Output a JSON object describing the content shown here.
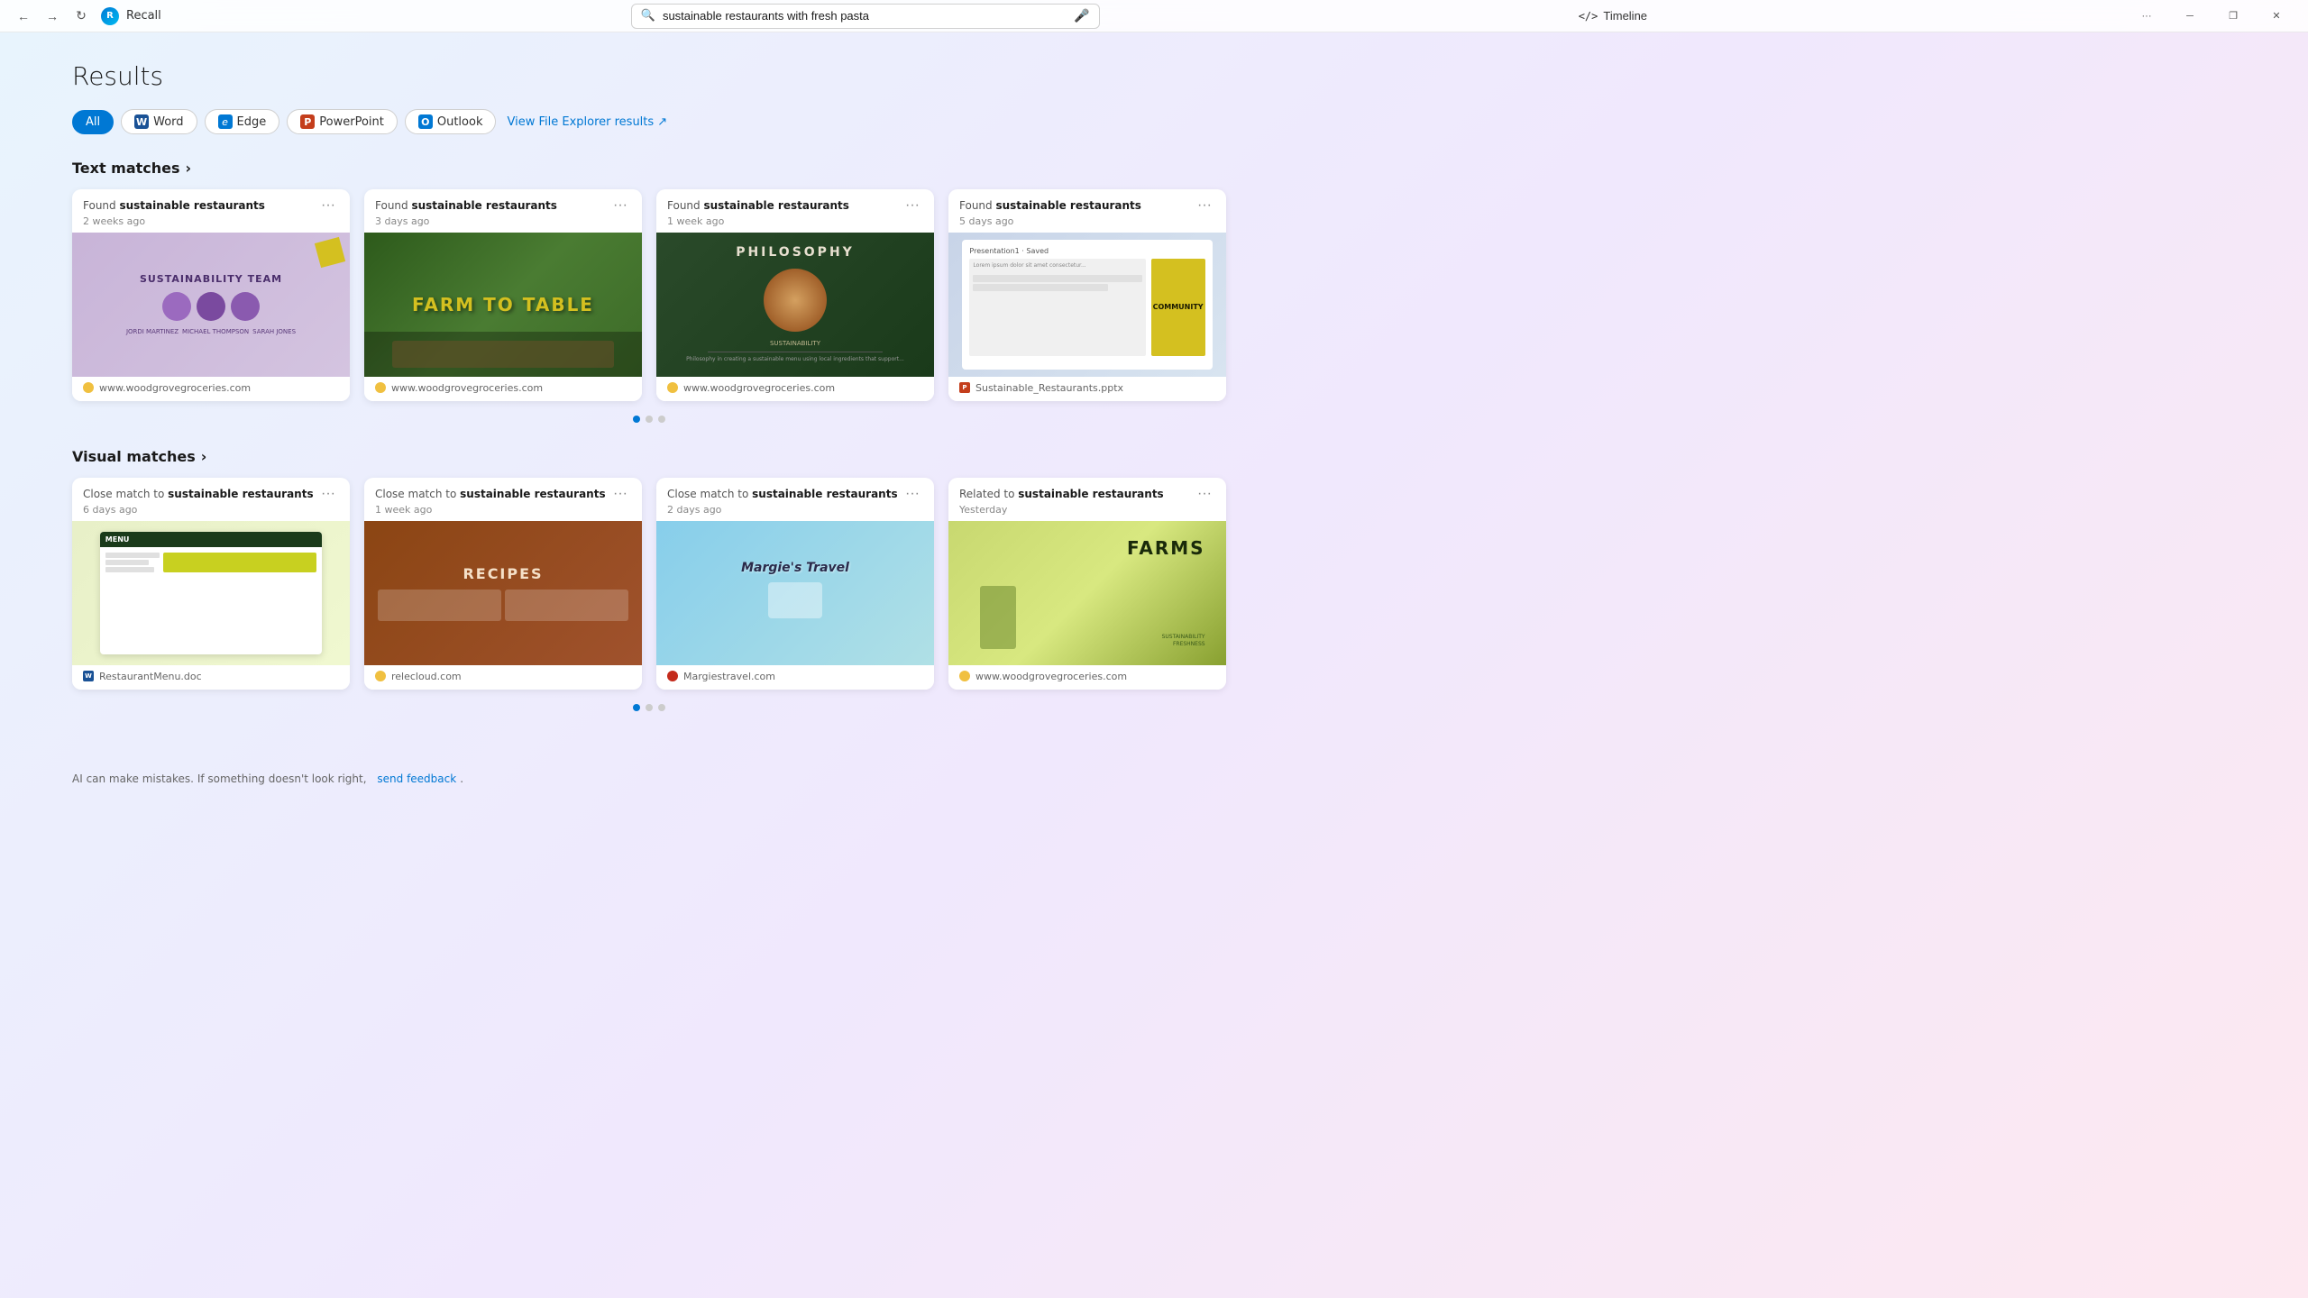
{
  "titlebar": {
    "back_label": "←",
    "forward_label": "→",
    "refresh_label": "↻",
    "app_icon_text": "R",
    "app_title": "Recall",
    "search_value": "sustainable restaurants with fresh pasta",
    "mic_icon": "🎤",
    "timeline_icon": "</>",
    "timeline_label": "Timeline",
    "more_label": "···",
    "minimize_label": "─",
    "restore_label": "❐",
    "close_label": "✕"
  },
  "page": {
    "title": "Results"
  },
  "filters": [
    {
      "id": "all",
      "label": "All",
      "active": true,
      "icon": null,
      "icon_color": null
    },
    {
      "id": "word",
      "label": "Word",
      "active": false,
      "icon": "W",
      "icon_color": "#1a5296"
    },
    {
      "id": "edge",
      "label": "Edge",
      "active": false,
      "icon": "e",
      "icon_color": "#0078d4"
    },
    {
      "id": "powerpoint",
      "label": "PowerPoint",
      "active": false,
      "icon": "P",
      "icon_color": "#c43e1c"
    },
    {
      "id": "outlook",
      "label": "Outlook",
      "active": false,
      "icon": "O",
      "icon_color": "#0078d4"
    }
  ],
  "file_explorer_link": "View File Explorer results ↗",
  "sections": {
    "text_matches": {
      "label": "Text matches",
      "arrow": "›",
      "cards": [
        {
          "id": "tm1",
          "prefix": "Found ",
          "highlight": "sustainable restaurants",
          "date": "2 weeks ago",
          "source": "www.woodgrovegroceries.com",
          "source_type": "web",
          "image_type": "sustainability"
        },
        {
          "id": "tm2",
          "prefix": "Found ",
          "highlight": "sustainable restaurants",
          "date": "3 days ago",
          "source": "www.woodgrovegroceries.com",
          "source_type": "web",
          "image_type": "farmtotable"
        },
        {
          "id": "tm3",
          "prefix": "Found ",
          "highlight": "sustainable restaurants",
          "date": "1 week ago",
          "source": "www.woodgrovegroceries.com",
          "source_type": "web",
          "image_type": "philosophy"
        },
        {
          "id": "tm4",
          "prefix": "Found ",
          "highlight": "sustainable restaurants",
          "date": "5 days ago",
          "source": "Sustainable_Restaurants.pptx",
          "source_type": "pptx",
          "image_type": "community"
        }
      ]
    },
    "visual_matches": {
      "label": "Visual matches",
      "arrow": "›",
      "cards": [
        {
          "id": "vm1",
          "prefix": "Close match to ",
          "highlight": "sustainable restaurants",
          "date": "6 days ago",
          "source": "RestaurantMenu.doc",
          "source_type": "doc",
          "image_type": "menu"
        },
        {
          "id": "vm2",
          "prefix": "Close match to ",
          "highlight": "sustainable restaurants",
          "date": "1 week ago",
          "source": "relecloud.com",
          "source_type": "web",
          "image_type": "recipes"
        },
        {
          "id": "vm3",
          "prefix": "Close match to ",
          "highlight": "sustainable restaurants",
          "date": "2 days ago",
          "source": "Margiestravel.com",
          "source_type": "web_red",
          "image_type": "travel"
        },
        {
          "id": "vm4",
          "prefix": "Related to ",
          "highlight": "sustainable restaurants",
          "date": "Yesterday",
          "source": "www.woodgrovegroceries.com",
          "source_type": "web",
          "image_type": "farms"
        }
      ]
    }
  },
  "dots": {
    "text_matches": [
      true,
      false,
      false
    ],
    "visual_matches": [
      true,
      false,
      false
    ]
  },
  "footer": {
    "disclaimer": "AI can make mistakes. If something doesn't look right,",
    "feedback_link": "send feedback",
    "feedback_suffix": "."
  },
  "icons": {
    "search": "🔍",
    "mic": "🎤",
    "chevron_right": "›",
    "more": "···",
    "word_blue": "#1a5296",
    "edge_blue": "#0078d4",
    "ppt_orange": "#c43e1c",
    "outlook_blue": "#0078d4"
  }
}
